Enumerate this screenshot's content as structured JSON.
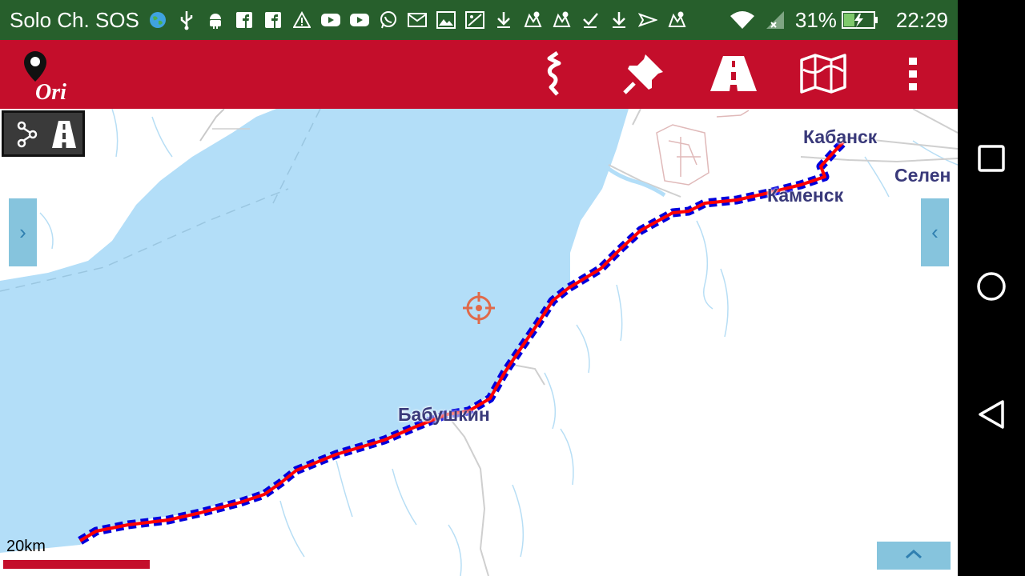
{
  "status_bar": {
    "carrier": "Solo Ch. SOS",
    "battery_percent": "31%",
    "time": "22:29",
    "notification_icons": [
      "globe-icon",
      "usb-icon",
      "android-icon",
      "facebook-icon",
      "facebook-icon",
      "warning-icon",
      "youtube-icon",
      "youtube-icon",
      "whatsapp-icon",
      "mail-icon",
      "gallery-icon",
      "image-icon",
      "download-icon",
      "map-marker-icon",
      "map-marker-icon",
      "check-icon",
      "download-icon",
      "send-icon",
      "map-marker-icon"
    ]
  },
  "toolbar": {
    "app_logo_text": "Ori",
    "actions": [
      "route-icon",
      "pin-icon",
      "road-icon",
      "map-icon",
      "more-icon"
    ]
  },
  "map": {
    "places": {
      "kabansk": "Кабанск",
      "selenginsk": "Селен",
      "kamensk": "Каменск",
      "babushkin": "Бабушкин"
    },
    "scale_label": "20km",
    "left_tab_glyph": "›",
    "right_tab_glyph": "‹"
  },
  "colors": {
    "status_bar": "#275f2c",
    "toolbar": "#c40e2b",
    "water": "#b3def8",
    "route_red": "#ff0000",
    "route_blue": "#0000dd",
    "side_tab": "#86c4dd"
  }
}
